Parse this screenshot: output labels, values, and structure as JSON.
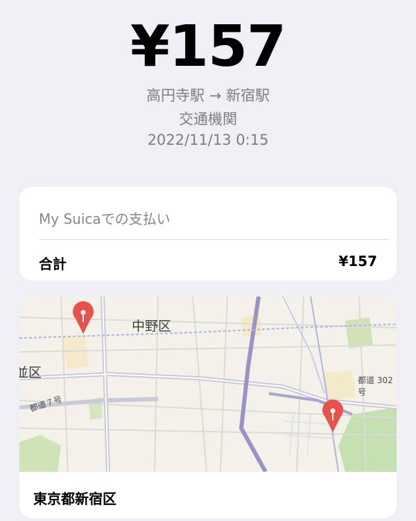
{
  "transaction": {
    "amount": "¥157",
    "route": "高円寺駅 → 新宿駅",
    "category": "交通機関",
    "datetime": "2022/11/13 0:15"
  },
  "payment": {
    "method_label": "My Suicaでの支払い",
    "total_label": "合計",
    "total_value": "¥157"
  },
  "map": {
    "area_label": "中野区",
    "partial_label": "並区",
    "road_label_1": "都道７号",
    "road_label_2": "都道 302 号",
    "location_name": "東京都新宿区",
    "pin_color": "#e8524a"
  }
}
